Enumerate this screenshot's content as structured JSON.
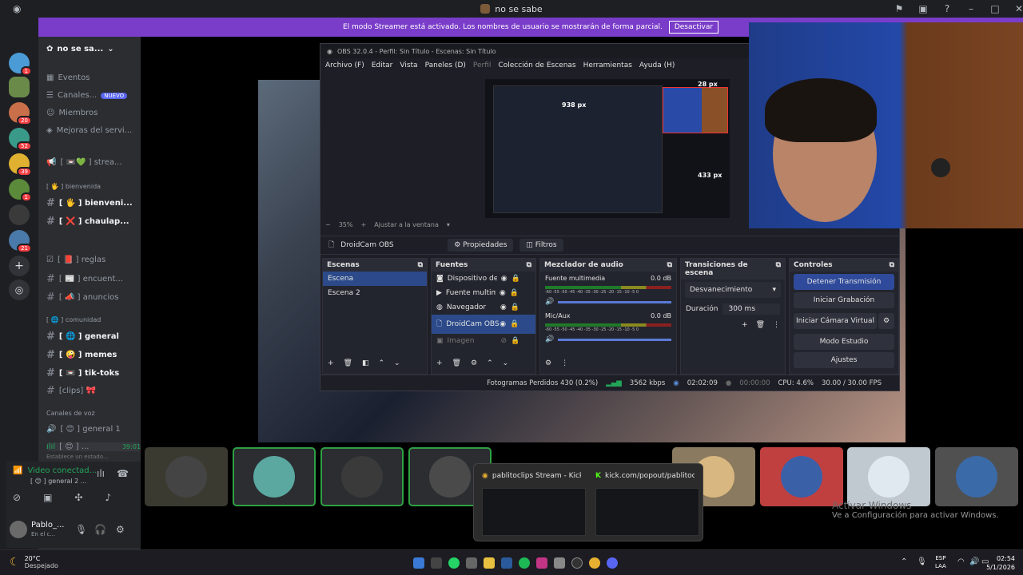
{
  "window": {
    "title": "no se sabe"
  },
  "streamer_banner": {
    "text": "El modo Streamer está activado. Los nombres de usuario se mostrarán de forma parcial.",
    "button": "Desactivar"
  },
  "server": {
    "name": "no se sa...",
    "nav": [
      "Eventos",
      "Canales...",
      "Miembros",
      "Mejoras del servi..."
    ],
    "badge_new": "NUEVO"
  },
  "rail_badges": [
    "1",
    "20",
    "52",
    "39",
    "1",
    "21"
  ],
  "channels": {
    "stream_item": "[ 📼💚 ] strea...",
    "cat_bienvenida": "[ 🖐 ] bienvenida",
    "bienvenida": "[ 🖐 ] bienveni...",
    "chaulap": "[ ❌ ] chaulap...",
    "reglas": "[ 📕 ] reglas",
    "encuent": "[ 📰 ] encuent...",
    "anuncios": "[ 📣 ] anuncios",
    "cat_comunidad": "[ 🌐 ] comunidad",
    "general": "[ 🌐 ] general",
    "memes": "[ 🤪 ] memes",
    "tiktoks": "[ 📼 ] tik-toks",
    "clips": "[clips] 🎀",
    "cat_voz": "Canales de voz",
    "general1": "[ 😊 ] general 1",
    "live_user": "[ 😊 ] ...",
    "live_time": "39:01",
    "status_hint": "Establece un estado..."
  },
  "voice_panel": {
    "status": "Video conectad...",
    "channel": "[ 😊 ] general 2 ...",
    "user": "Pablo_...",
    "user_status": "En el c..."
  },
  "obs": {
    "title": "OBS 32.0.4 - Perfil: Sin Título - Escenas: Sin Título",
    "menu": [
      "Archivo (F)",
      "Editar",
      "Vista",
      "Paneles (D)",
      "Perfil",
      "Colección de Escenas",
      "Herramientas",
      "Ayuda (H)"
    ],
    "preview_labels": [
      "938 px",
      "28 px",
      "433 px"
    ],
    "zoom": "35%",
    "fit": "Ajustar a la ventana",
    "source_name": "DroidCam OBS",
    "properties": "Propiedades",
    "filters": "Filtros",
    "scenes_title": "Escenas",
    "scenes": [
      "Escena",
      "Escena 2"
    ],
    "sources_title": "Fuentes",
    "sources": [
      "Dispositivo de c...",
      "Fuente multime...",
      "Navegador",
      "DroidCam OBS",
      "Imagen"
    ],
    "mixer_title": "Mezclador de audio",
    "mixer": [
      {
        "name": "Fuente multimedia",
        "db": "0.0 dB"
      },
      {
        "name": "Mic/Aux",
        "db": "0.0 dB"
      }
    ],
    "meter_scale": "-60 -55 -50 -45 -40 -35 -30 -25 -20 -15 -10 -5 0",
    "transitions_title": "Transiciones de escena",
    "transition": "Desvanecimiento",
    "duration_label": "Duración",
    "duration": "300 ms",
    "controls_title": "Controles",
    "controls": [
      "Detener Transmisión",
      "Iniciar Grabación",
      "Iniciar Cámara Virtual",
      "Modo Estudio",
      "Ajustes"
    ],
    "status": {
      "dropped": "Fotogramas Perdidos 430 (0.2%)",
      "kbps": "3562 kbps",
      "live": "02:02:09",
      "rec": "00:00:00",
      "cpu": "CPU: 4.6%",
      "fps": "30.00 / 30.00 FPS"
    }
  },
  "popup": {
    "tab1": "pablitoclips Stream - Kick...",
    "tab2": "kick.com/popout/pablitocl..."
  },
  "activate": {
    "title": "Activar Windows",
    "sub": "Ve a Configuración para activar Windows."
  },
  "taskbar": {
    "weather_temp": "20°C",
    "weather": "Despejado",
    "lang1": "ESP",
    "lang2": "LAA",
    "time": "02:54",
    "date": "5/1/2026"
  }
}
